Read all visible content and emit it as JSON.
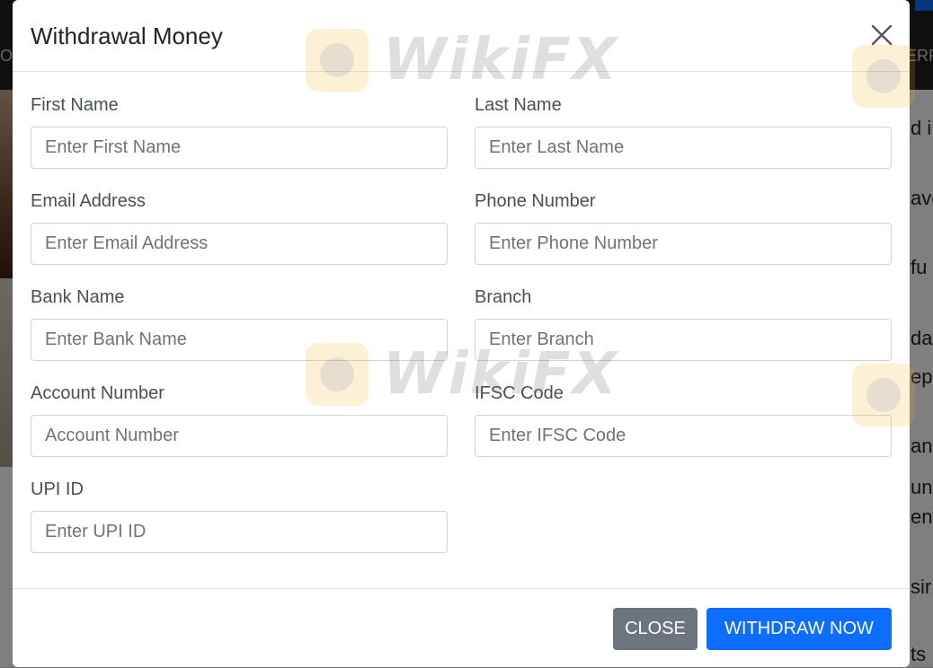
{
  "background": {
    "nav_left": "O",
    "nav_right": "ERR",
    "fragments": [
      "d i",
      "avo",
      "fu",
      "day",
      "epo",
      "an",
      "unt",
      "ent",
      "sir",
      "ts"
    ]
  },
  "modal": {
    "title": "Withdrawal Money",
    "fields": {
      "first_name": {
        "label": "First Name",
        "placeholder": "Enter First Name",
        "value": ""
      },
      "last_name": {
        "label": "Last Name",
        "placeholder": "Enter Last Name",
        "value": ""
      },
      "email": {
        "label": "Email Address",
        "placeholder": "Enter Email Address",
        "value": ""
      },
      "phone": {
        "label": "Phone Number",
        "placeholder": "Enter Phone Number",
        "value": ""
      },
      "bank_name": {
        "label": "Bank Name",
        "placeholder": "Enter Bank Name",
        "value": ""
      },
      "branch": {
        "label": "Branch",
        "placeholder": "Enter Branch",
        "value": ""
      },
      "account_number": {
        "label": "Account Number",
        "placeholder": "Account Number",
        "value": ""
      },
      "ifsc": {
        "label": "IFSC Code",
        "placeholder": "Enter IFSC Code",
        "value": ""
      },
      "upi": {
        "label": "UPI ID",
        "placeholder": "Enter UPI ID",
        "value": ""
      }
    },
    "footer": {
      "close_label": "CLOSE",
      "withdraw_label": "WITHDRAW NOW"
    }
  },
  "watermark": {
    "text": "WikiFX"
  },
  "colors": {
    "primary": "#0d6efd",
    "secondary": "#6c757d",
    "backdrop": "#000000"
  }
}
